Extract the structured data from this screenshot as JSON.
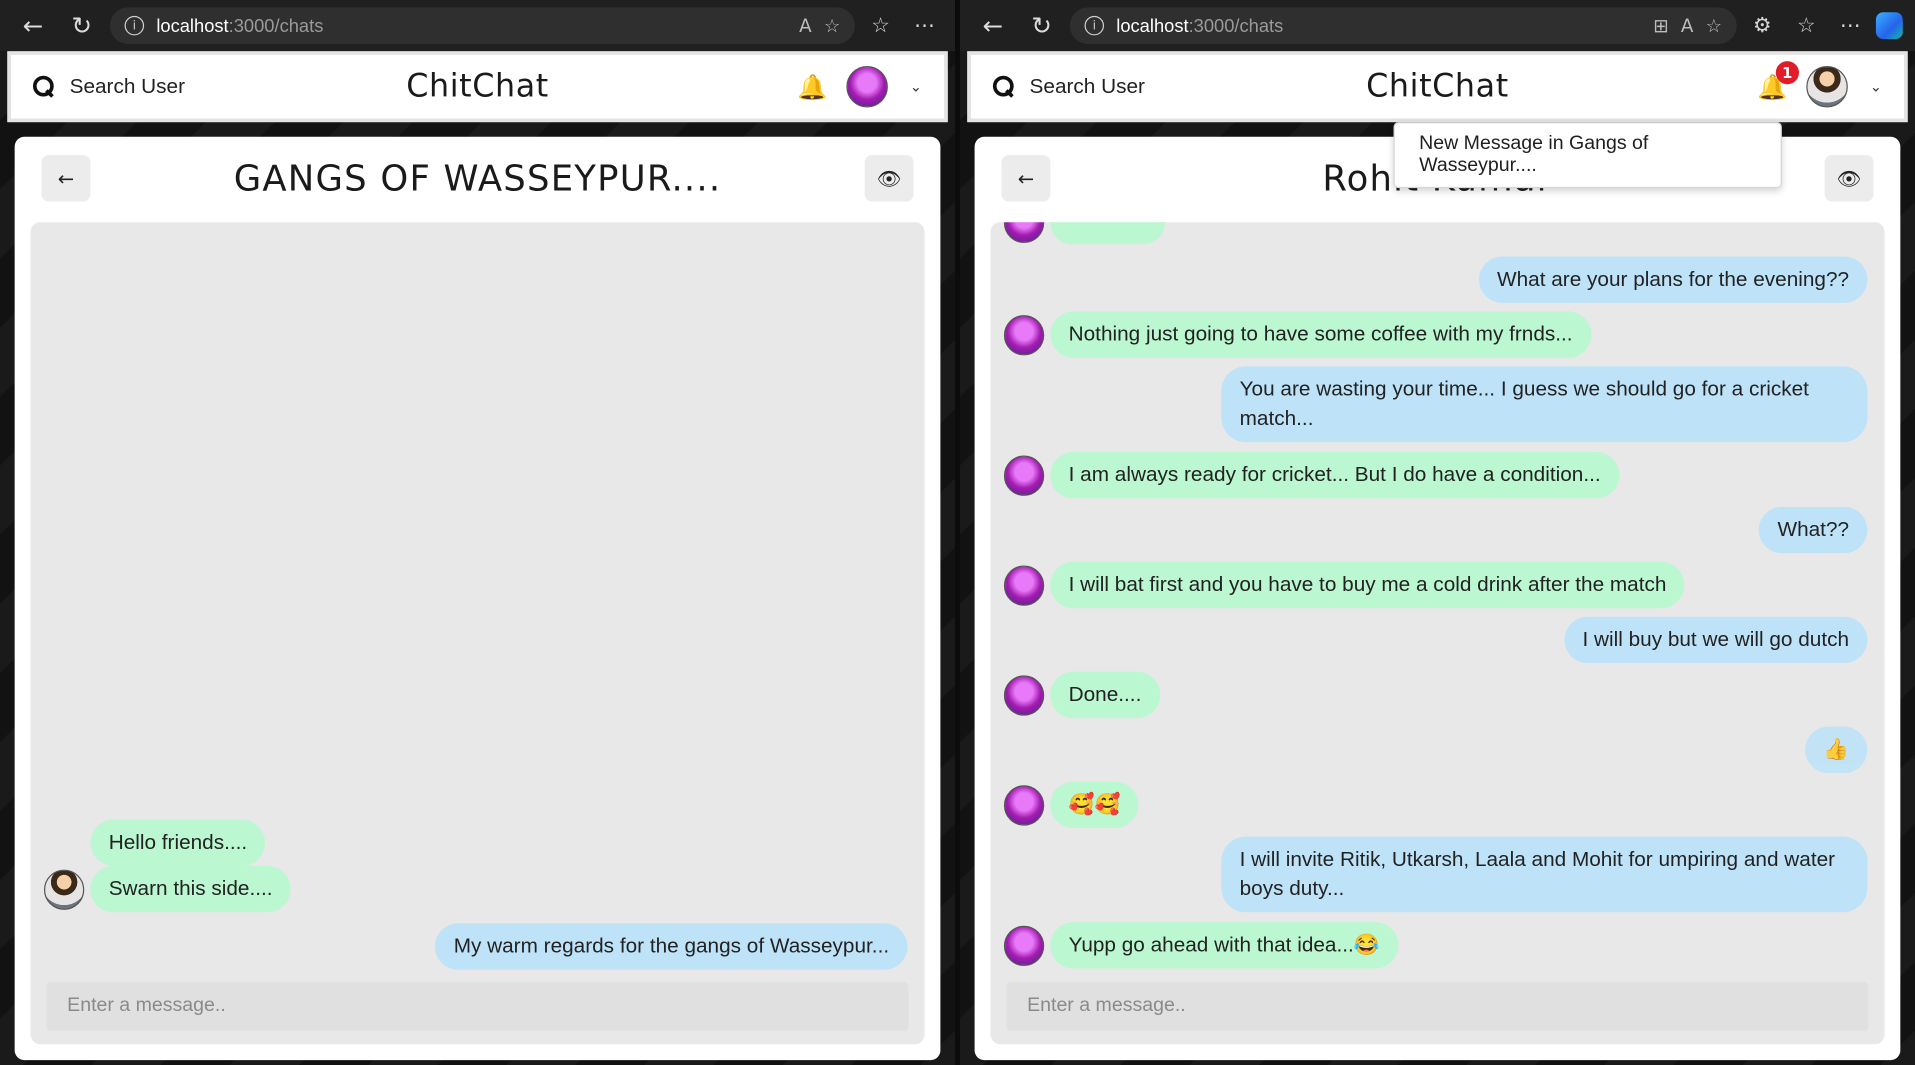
{
  "browser": {
    "url_host": "localhost",
    "url_path": ":3000/chats"
  },
  "app": {
    "brand": "ChitChat",
    "search_label": "Search User",
    "input_placeholder": "Enter a message.."
  },
  "left_window": {
    "chat_title": "GANGS OF WASSEYPUR....",
    "messages": [
      {
        "from": "them",
        "text": "Hello friends...."
      },
      {
        "from": "them",
        "text": "Swarn this side...."
      },
      {
        "from": "me",
        "text": "My warm regards for the gangs of Wasseypur..."
      }
    ]
  },
  "right_window": {
    "chat_title": "Rohit Kumar",
    "notification_count": "1",
    "notification_text": "New Message in Gangs of Wasseypur....",
    "messages": [
      {
        "from": "me",
        "text": "What are your plans for the evening??"
      },
      {
        "from": "them",
        "text": "Nothing just going to have some coffee with my frnds..."
      },
      {
        "from": "me",
        "text": "You are wasting your time... I guess we should go for a cricket match..."
      },
      {
        "from": "them",
        "text": "I am always ready for cricket... But I do have a condition..."
      },
      {
        "from": "me",
        "text": "What??"
      },
      {
        "from": "them",
        "text": "I will bat first and you have to buy me a cold drink after the match"
      },
      {
        "from": "me",
        "text": "I will buy but we will go dutch"
      },
      {
        "from": "them",
        "text": "Done...."
      },
      {
        "from": "me",
        "text": "👍"
      },
      {
        "from": "them",
        "text": "🥰🥰"
      },
      {
        "from": "me",
        "text": "I will invite Ritik, Utkarsh, Laala and Mohit for umpiring and water boys duty..."
      },
      {
        "from": "them",
        "text": "Yupp go ahead with that idea...😂"
      }
    ]
  }
}
